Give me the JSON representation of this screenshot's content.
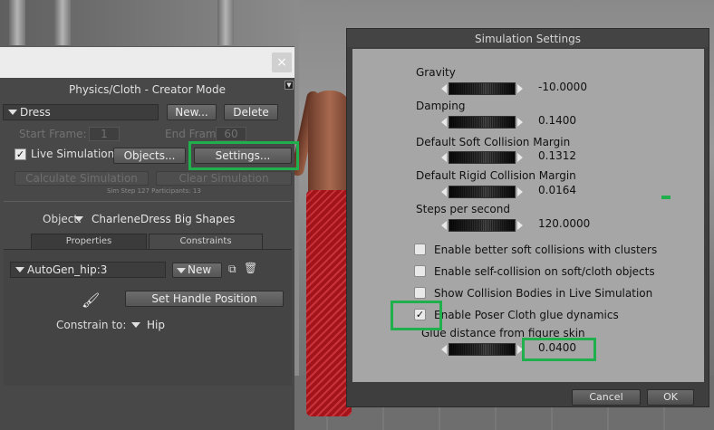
{
  "physics_panel": {
    "close_glyph": "×",
    "title": "Physics/Cloth - Creator Mode",
    "cloth_select": "Dress",
    "new_label": "New...",
    "delete_label": "Delete",
    "start_frame_label": "Start Frame:",
    "start_frame_value": "1",
    "end_frame_label": "End Frame:",
    "end_frame_value": "60",
    "live_simulation_label": "Live Simulation",
    "live_simulation_checked": true,
    "objects_label": "Objects...",
    "settings_label": "Settings...",
    "calculate_label": "Calculate Simulation",
    "clear_label": "Clear Simulation",
    "status": "Sim Step 127  Participants: 13",
    "object_label": "Object:",
    "object_value": "CharleneDress Big Shapes",
    "tabs": [
      {
        "label": "Properties",
        "active": false
      },
      {
        "label": "Constraints",
        "active": true
      }
    ],
    "constraint_select": "AutoGen_hip:3",
    "constraint_new_label": "New",
    "set_handle_label": "Set Handle Position",
    "constrain_to_label": "Constrain to:",
    "constrain_to_value": "Hip"
  },
  "sim_settings": {
    "title": "Simulation Settings",
    "fields": [
      {
        "label": "Gravity",
        "value": "-10.0000"
      },
      {
        "label": "Damping",
        "value": "0.1400"
      },
      {
        "label": "Default Soft Collision Margin",
        "value": "0.1312"
      },
      {
        "label": "Default Rigid Collision Margin",
        "value": "0.0164"
      },
      {
        "label": "Steps per second",
        "value": "120.0000"
      }
    ],
    "options": [
      {
        "label": "Enable better soft collisions with clusters",
        "checked": false
      },
      {
        "label": "Enable self-collision on soft/cloth objects",
        "checked": false
      },
      {
        "label": "Show Collision Bodies in Live Simulation",
        "checked": false
      },
      {
        "label": "Enable Poser Cloth glue dynamics",
        "checked": true
      }
    ],
    "glue_label": "Glue distance from figure skin",
    "glue_value": "0.0400",
    "cancel_label": "Cancel",
    "ok_label": "OK"
  },
  "colors": {
    "highlight": "#1fb04d",
    "panel_bg": "#484848",
    "dialog_bg": "#a6a6a6"
  }
}
